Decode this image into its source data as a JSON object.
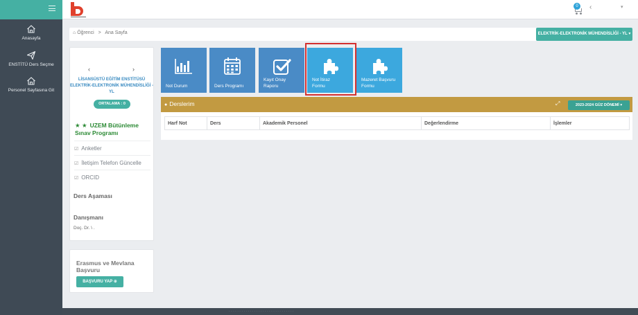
{
  "topbar": {
    "cart_count": "0",
    "lang_chevron": "‹",
    "user_chevron": "▾"
  },
  "sidebar": {
    "items": [
      {
        "label": "Anasayfa",
        "icon": "home-icon"
      },
      {
        "label": "ENSTİTÜ Ders Seçme",
        "icon": "paper-plane-icon"
      },
      {
        "label": "Personel Sayfasına Git",
        "icon": "home-icon"
      }
    ]
  },
  "breadcrumb": {
    "root": "Öğrenci",
    "separator": ">",
    "current": "Ana Sayfa"
  },
  "department_button": "ELEKTRİK-ELEKTRONİK MÜHENDİSLİĞİ - YL ▾",
  "profile": {
    "prev": "‹",
    "next": "›",
    "institute": "LİSANSÜSTÜ EĞİTİM ENSTİTÜSÜ",
    "department": "ELEKTRİK-ELEKTRONİK MÜHENDİSLİĞİ - YL",
    "gpa_label": "ORTALAMA : 0",
    "uzem_stars": "★ ★",
    "uzem_title": "UZEM Bütünleme Sınav Programı",
    "menu": [
      {
        "label": "Anketler",
        "icon": "check-square-icon"
      },
      {
        "label": "İletişim Telefon Güncelle",
        "icon": "check-square-icon"
      },
      {
        "label": "ORCID",
        "icon": "check-square-icon"
      }
    ],
    "stage_heading": "Ders Aşaması",
    "advisor_heading": "Danışmanı",
    "advisor_name": "Doç. Dr. \\               ."
  },
  "erasmus": {
    "title": "Erasmus ve Mevlana Başvuru",
    "button": "BAŞVURU YAP ⊕"
  },
  "tiles": [
    {
      "label": "Not Durum",
      "icon": "bar-chart-icon",
      "active": false
    },
    {
      "label": "Ders Programı",
      "icon": "calendar-icon",
      "active": false
    },
    {
      "label": "Kayıt Onay Raporu",
      "icon": "checkbox-icon",
      "active": false
    },
    {
      "label": "Not İtiraz Formu",
      "icon": "puzzle-icon",
      "active": true
    },
    {
      "label": "Mazeret Başvuru Formu",
      "icon": "puzzle-icon",
      "active": true
    }
  ],
  "courses": {
    "title": "Derslerim",
    "expand_icon": "⤢",
    "term_button": "2023-2024 GÜZ DÖNEMİ ▾",
    "columns": [
      "Harf Not",
      "Ders",
      "Akademik Personel",
      "Değerlendirme",
      "İşlemler"
    ]
  },
  "footer": {
    "text": "· · · · · · · · · · · · · · · · · · · · · · · · · · · · · · ·"
  },
  "colors": {
    "teal": "#45b0a3",
    "sidebar": "#3f4a55",
    "tile_blue": "#4a8bc6",
    "tile_active": "#3ca8de",
    "courses_header": "#c29a41",
    "highlight": "#d32f2f"
  }
}
